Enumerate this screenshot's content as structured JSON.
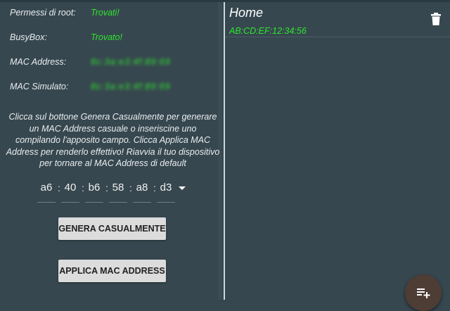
{
  "status": {
    "root_label": "Permessi di root:",
    "root_value": "Trovati!",
    "busybox_label": "BusyBox:",
    "busybox_value": "Trovato!",
    "mac_label": "MAC Address:",
    "mac_value": "8c:3a:e3:4f:89:69",
    "simulated_label": "MAC Simulato:",
    "simulated_value": "8c:3a:e3:4f:89:69"
  },
  "instructions": "Clicca sul bottone Genera Casualmente per generare un MAC Address casuale o inseriscine uno compilando l'apposito campo. Clicca Applica MAC Address per renderlo effettivo! Riavvia il tuo dispositivo per tornare al MAC Address di default",
  "mac_input": {
    "octets": [
      "a6",
      "40",
      "b6",
      "58",
      "a8",
      "d3"
    ],
    "separator": ":"
  },
  "buttons": {
    "generate": "GENERA CASUALMENTE",
    "apply": "APPLICA MAC ADDRESS"
  },
  "saved": {
    "title": "Home",
    "entry": "AB:CD:EF:12:34:56"
  },
  "icons": {
    "delete": "trash-icon",
    "add": "playlist-add-icon"
  },
  "colors": {
    "background": "#37474f",
    "accent_green": "#2ee62e",
    "button_bg": "#dcdcdc",
    "fab_bg": "#4e3d35"
  }
}
